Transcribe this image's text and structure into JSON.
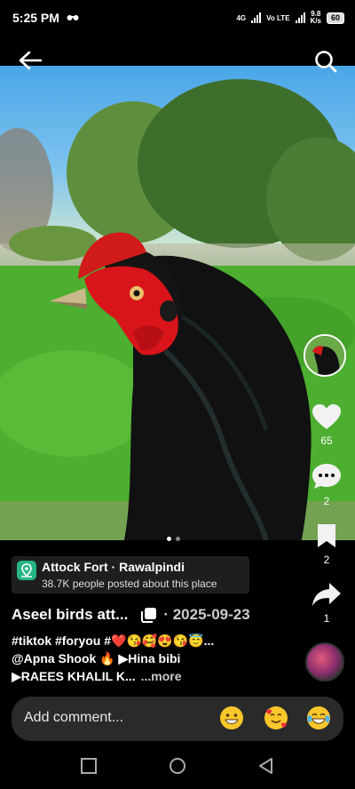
{
  "status_bar": {
    "time": "5:25 PM",
    "network_left": "4G",
    "network_right": "Vo LTE",
    "speed_value": "9.8",
    "speed_unit": "K/s",
    "battery": "60"
  },
  "icons": {
    "back": "back-arrow-icon",
    "search": "search-icon",
    "like": "heart-icon",
    "comment": "comment-icon",
    "bookmark": "bookmark-icon",
    "share": "share-icon"
  },
  "post": {
    "likes": "65",
    "comments": "2",
    "saves": "2",
    "shares": "1",
    "image_index": 0,
    "image_count": 2
  },
  "location": {
    "name": "Attock Fort · Rawalpindi",
    "subtitle": "38.7K people posted about this place"
  },
  "title": "Aseel birds att...",
  "date": "· 2025-09-23",
  "caption": {
    "line1": "#tiktok #foryou #❤️😘🥰😍😘😇...",
    "line2": "@Apna Shook 🔥  ▶Hina bibi",
    "line3": "▶RAEES KHALIL K...",
    "more": "...more"
  },
  "comment_bar": {
    "placeholder": "Add comment...",
    "emojis": [
      "grinning-face",
      "smiling-face-with-hearts",
      "tears-of-joy-face"
    ]
  },
  "colors": {
    "background": "#000000",
    "location_icon": "#25b587",
    "comment_bar": "#2a2a2a"
  }
}
